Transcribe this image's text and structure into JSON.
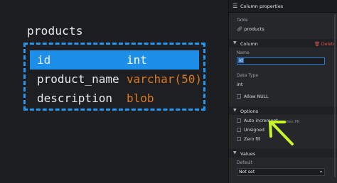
{
  "canvas": {
    "table_name": "products",
    "columns": [
      {
        "name": "id",
        "type": "int",
        "selected": true
      },
      {
        "name": "product_name",
        "type": "varchar(50)",
        "selected": false
      },
      {
        "name": "description",
        "type": "blob",
        "selected": false
      }
    ]
  },
  "panel": {
    "header_icon": "sliders-icon",
    "header_title": "Column properties",
    "table_label": "Table",
    "table_value": "products",
    "column_section": "Column",
    "delete_label": "Delete",
    "name_label": "Name",
    "name_value": "id",
    "datatype_label": "Data Type",
    "datatype_value": "int",
    "allow_null_label": "Allow NULL",
    "options_section": "Options",
    "auto_increment_label": "Auto increment",
    "auto_increment_hint": "creates PK",
    "unsigned_label": "Unsigned",
    "zerofill_label": "Zero fill",
    "values_section": "Values",
    "default_label": "Default",
    "default_value": "Not set"
  },
  "colors": {
    "selection": "#1e8fe8",
    "dashed_border": "#2196f3",
    "type_text": "#e07a22",
    "annotation_arrow": "#c8f52a",
    "delete": "#e0554a"
  }
}
